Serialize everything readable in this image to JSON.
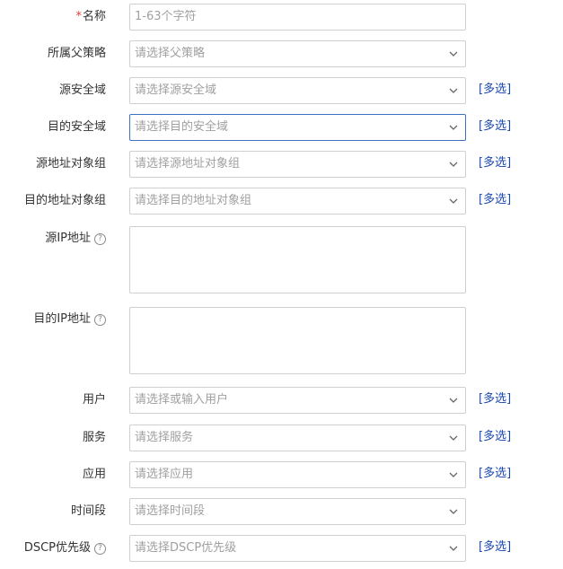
{
  "form": {
    "name": {
      "required_mark": "*",
      "label": "名称",
      "placeholder": "1-63个字符"
    },
    "parent_policy": {
      "label": "所属父策略",
      "placeholder": "请选择父策略"
    },
    "src_zone": {
      "label": "源安全域",
      "placeholder": "请选择源安全域",
      "multi": "[多选]"
    },
    "dst_zone": {
      "label": "目的安全域",
      "placeholder": "请选择目的安全域",
      "multi": "[多选]"
    },
    "src_addr_group": {
      "label": "源地址对象组",
      "placeholder": "请选择源地址对象组",
      "multi": "[多选]"
    },
    "dst_addr_group": {
      "label": "目的地址对象组",
      "placeholder": "请选择目的地址对象组",
      "multi": "[多选]"
    },
    "src_ip": {
      "label": "源IP地址",
      "help": "?"
    },
    "dst_ip": {
      "label": "目的IP地址",
      "help": "?"
    },
    "user": {
      "label": "用户",
      "placeholder": "请选择或输入用户",
      "multi": "[多选]"
    },
    "service": {
      "label": "服务",
      "placeholder": "请选择服务",
      "multi": "[多选]"
    },
    "app": {
      "label": "应用",
      "placeholder": "请选择应用",
      "multi": "[多选]"
    },
    "time_range": {
      "label": "时间段",
      "placeholder": "请选择时间段"
    },
    "dscp": {
      "label": "DSCP优先级",
      "placeholder": "请选择DSCP优先级",
      "help": "?",
      "multi": "[多选]"
    }
  },
  "colors": {
    "link": "#1a47b0",
    "required": "#e4393c",
    "focus_border": "#3f6fbf",
    "border": "#cfcfcf"
  },
  "icons": {
    "dropdown": "chevron-down-icon",
    "help": "question-circle-icon"
  }
}
